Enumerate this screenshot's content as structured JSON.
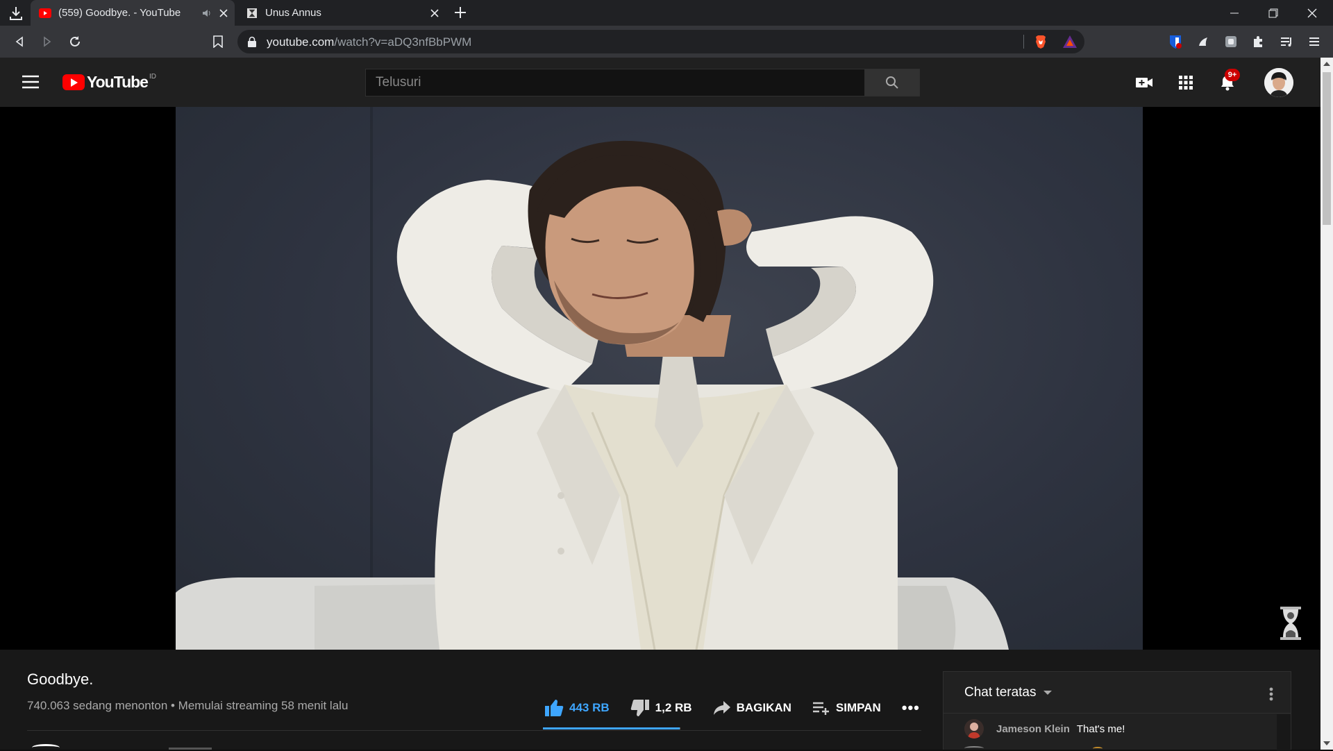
{
  "browser": {
    "tabs": [
      {
        "title": "(559) Goodbye. - YouTube",
        "active": true
      },
      {
        "title": "Unus Annus",
        "active": false
      }
    ],
    "address": {
      "host": "youtube.com",
      "path": "/watch?v=aDQ3nfBbPWM"
    }
  },
  "youtube": {
    "logo_text": "YouTube",
    "country_code": "ID",
    "search_placeholder": "Telusuri",
    "notification_count": "9+"
  },
  "video": {
    "title": "Goodbye.",
    "meta": "740.063 sedang menonton • Memulai streaming 58 menit lalu",
    "like_count": "443 RB",
    "dislike_count": "1,2 RB",
    "share_label": "BAGIKAN",
    "save_label": "SIMPAN",
    "more_label": "•••",
    "like_ratio": 0.997
  },
  "chat": {
    "mode_label": "Chat teratas",
    "messages": [
      {
        "author": "Jameson Klein",
        "text": "That's me!"
      }
    ]
  },
  "colors": {
    "accent_blue": "#3ea6ff",
    "yt_red": "#ff0000",
    "badge_red": "#cc0000",
    "masthead": "#202020",
    "page_bg": "#181818"
  },
  "icons": [
    "download-icon",
    "youtube-favicon",
    "mute-icon",
    "close-icon",
    "new-tab-icon",
    "minimize-icon",
    "restore-icon",
    "back-icon",
    "forward-icon",
    "reload-icon",
    "bookmark-icon",
    "lock-icon",
    "brave-shields-icon",
    "bat-rewards-icon",
    "hamburger-icon",
    "search-icon",
    "create-video-icon",
    "apps-grid-icon",
    "bell-icon",
    "thumbs-up-icon",
    "thumbs-down-icon",
    "share-icon",
    "playlist-add-icon",
    "kebab-menu-icon"
  ]
}
